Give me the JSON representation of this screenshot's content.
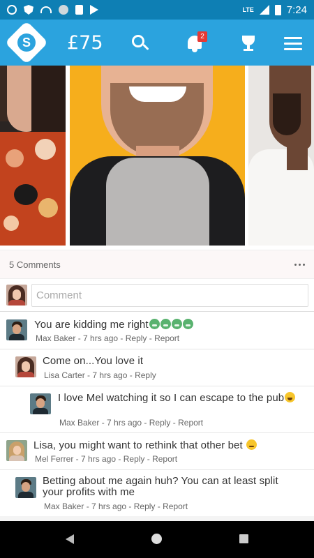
{
  "status_bar": {
    "network": "LTE",
    "time": "7:24"
  },
  "header": {
    "balance": "£75",
    "notification_count": "2",
    "colors": {
      "header_bg": "#2ba3de",
      "status_bg": "#0e7fb4",
      "badge": "#e53935"
    }
  },
  "comments_section": {
    "count_label": "5 Comments",
    "input_placeholder": "Comment",
    "comments": [
      {
        "author": "Max Baker",
        "text": "You are kidding me right",
        "emojis": [
          "nauseated-face",
          "nauseated-face",
          "nauseated-face",
          "nauseated-face"
        ],
        "time": "7 hrs ago",
        "reply_label": "Reply",
        "report_label": "Report"
      },
      {
        "author": "Lisa Carter",
        "text": "Come on...You love it",
        "time": "7 hrs ago",
        "reply_label": "Reply"
      },
      {
        "author": "Max Baker",
        "text": "I love Mel watching it so I can escape to the pub",
        "emojis": [
          "grinning-face"
        ],
        "time": "7 hrs ago",
        "reply_label": "Reply",
        "report_label": "Report"
      },
      {
        "author": "Mel Ferrer",
        "text": "Lisa, you might want to rethink that other bet",
        "emojis": [
          "winking-face"
        ],
        "time": "7 hrs ago",
        "reply_label": "Reply",
        "report_label": "Report"
      },
      {
        "author": "Max Baker",
        "text": "Betting about me again huh? You can at least split your profits with me",
        "time": "7 hrs ago",
        "reply_label": "Reply",
        "report_label": "Report"
      }
    ],
    "separator": " - "
  }
}
